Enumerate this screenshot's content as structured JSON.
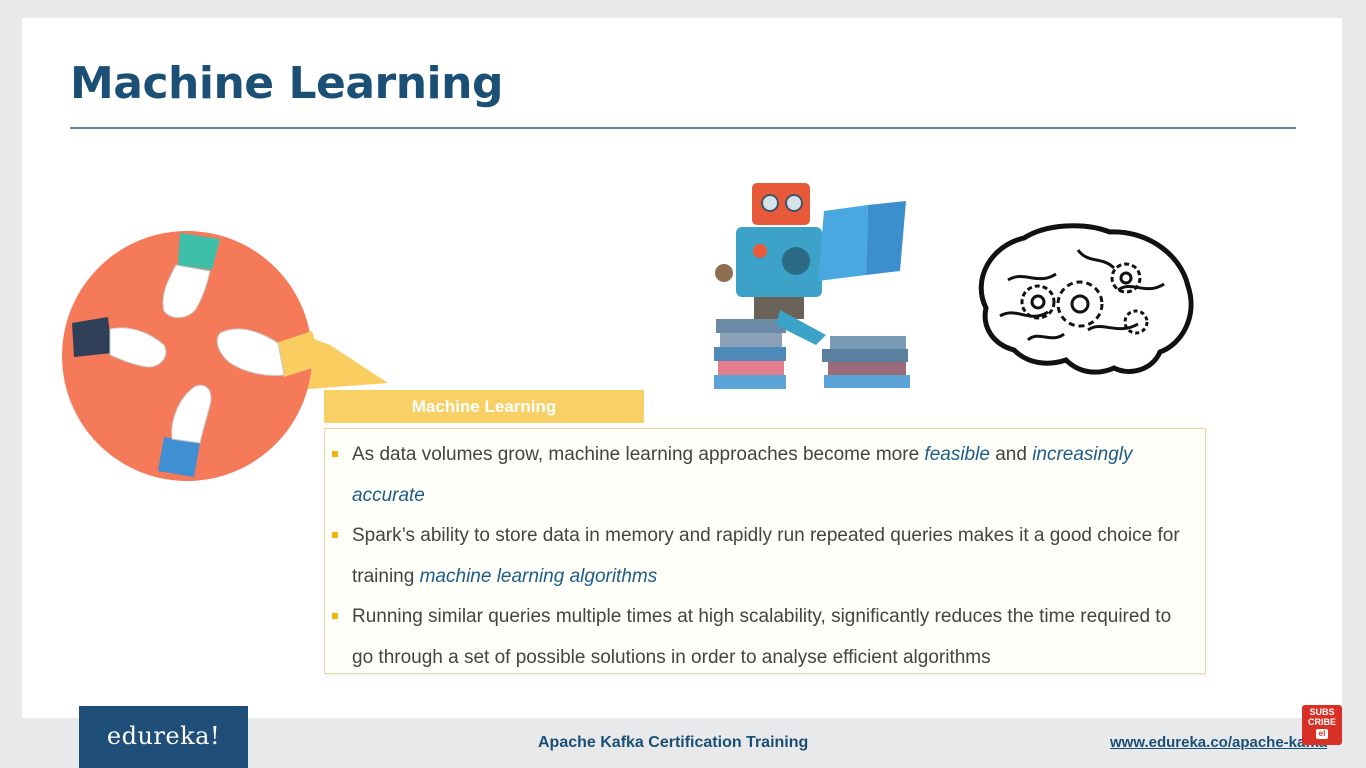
{
  "slide": {
    "title": "Machine Learning",
    "box_header": "Machine Learning",
    "bullets": [
      {
        "parts": [
          {
            "text": "As data volumes grow, machine learning approaches become more ",
            "em": false
          },
          {
            "text": "feasible",
            "em": true
          },
          {
            "text": " and ",
            "em": false
          },
          {
            "text": "increasingly accurate",
            "em": true
          }
        ]
      },
      {
        "parts": [
          {
            "text": "Spark’s ability to store data in memory and rapidly run repeated queries makes it a good choice for training ",
            "em": false
          },
          {
            "text": "machine learning algorithms",
            "em": true
          }
        ]
      },
      {
        "parts": [
          {
            "text": "Running similar queries multiple times at high scalability, significantly reduces the time required to go through a set of possible solutions in order to analyse efficient algorithms",
            "em": false
          }
        ]
      }
    ]
  },
  "footer": {
    "logo": "edureka!",
    "course": "Apache Kafka Certification Training",
    "url": "www.edureka.co/apache-kafka"
  },
  "subscribe": {
    "line1": "SUBS",
    "line2": "CRIBE",
    "icon_text": "el"
  },
  "colors": {
    "title": "#1b4f76",
    "accent_yellow": "#f8d066",
    "bullet_marker": "#f2b50c",
    "emphasis": "#1c5d8a",
    "logo_bg": "#1f4e79"
  },
  "icons": [
    "hands-teamwork-icon",
    "robot-reading-icon",
    "brain-gears-icon",
    "subscribe-icon"
  ]
}
